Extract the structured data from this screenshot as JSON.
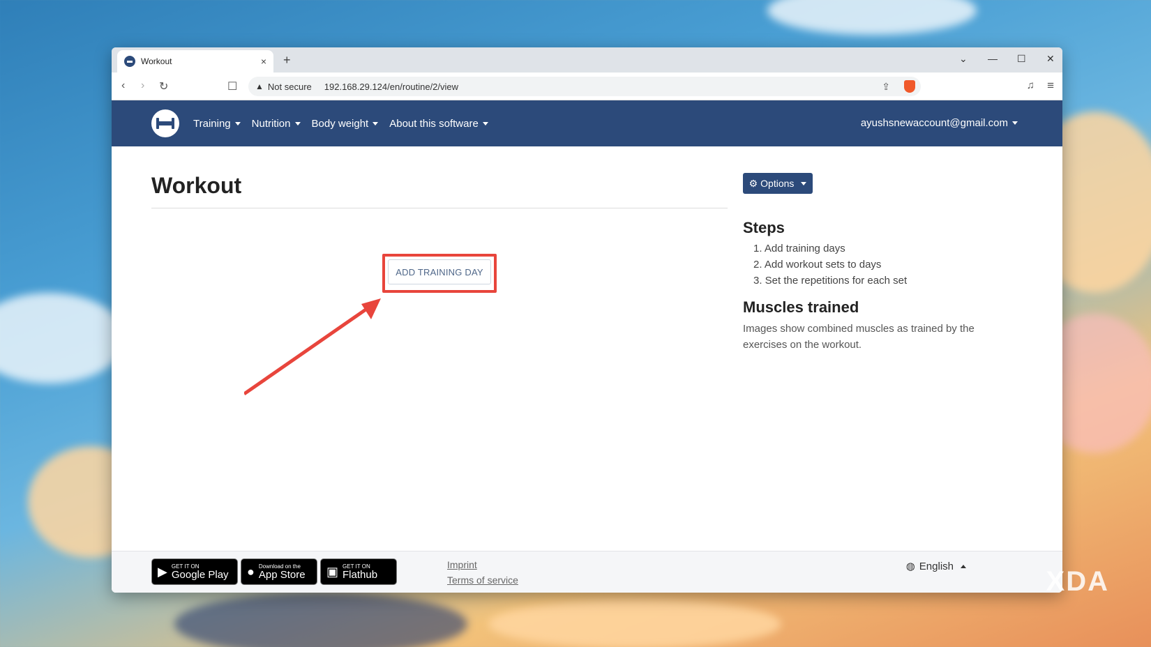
{
  "browser": {
    "tab_title": "Workout",
    "close_glyph": "×",
    "newtab_glyph": "+",
    "not_secure": "Not secure",
    "url": "192.168.29.124/en/routine/2/view",
    "window_controls": {
      "dropdown": "⌄",
      "minimize": "—",
      "maximize": "☐",
      "close": "✕"
    }
  },
  "appnav": {
    "items": [
      {
        "label": "Training"
      },
      {
        "label": "Nutrition"
      },
      {
        "label": "Body weight"
      },
      {
        "label": "About this software"
      }
    ],
    "user": "ayushsnewaccount@gmail.com"
  },
  "main": {
    "title": "Workout",
    "add_day_button": "ADD TRAINING DAY"
  },
  "sidebar": {
    "options_label": "Options",
    "steps_heading": "Steps",
    "steps": [
      "1. Add training days",
      "2. Add workout sets to days",
      "3. Set the repetitions for each set"
    ],
    "muscles_heading": "Muscles trained",
    "muscles_text": "Images show combined muscles as trained by the exercises on the workout."
  },
  "footer": {
    "badges": [
      {
        "small": "GET IT ON",
        "big": "Google Play",
        "icon": "▶"
      },
      {
        "small": "Download on the",
        "big": "App Store",
        "icon": ""
      },
      {
        "small": "GET IT ON",
        "big": "Flathub",
        "icon": "▣"
      }
    ],
    "imprint": "Imprint",
    "terms": "Terms of service",
    "language": "English"
  },
  "watermark": "XDA",
  "colors": {
    "navbar": "#2c4a7a",
    "highlight": "#e8453c"
  }
}
